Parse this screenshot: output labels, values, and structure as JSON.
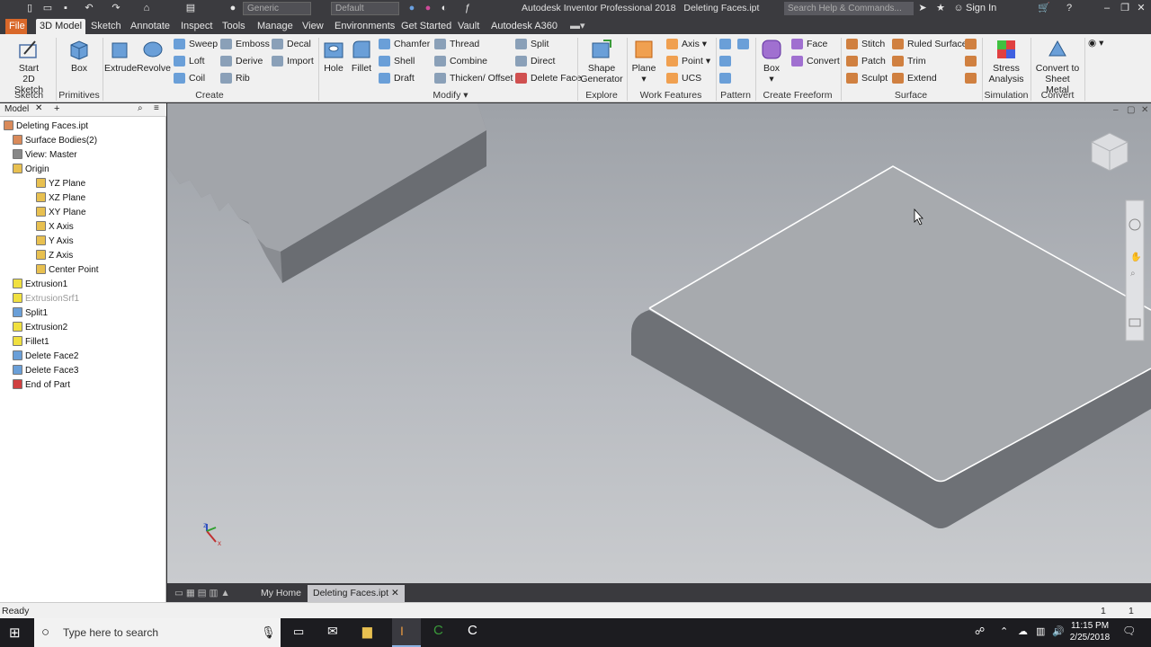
{
  "titlebar": {
    "title": "Autodesk Inventor Professional 2018",
    "document": "Deleting Faces.ipt",
    "material": "Generic",
    "appearance": "Default",
    "search_placeholder": "Search Help & Commands...",
    "sign_in": "Sign In"
  },
  "tabs": [
    "File",
    "3D Model",
    "Sketch",
    "Annotate",
    "Inspect",
    "Tools",
    "Manage",
    "View",
    "Environments",
    "Get Started",
    "Vault",
    "Autodesk A360"
  ],
  "active_tab": "3D Model",
  "ribbon": {
    "sketch": {
      "start": "Start",
      "start2": "2D Sketch",
      "group": "Sketch"
    },
    "primitives": {
      "box": "Box",
      "group": "Primitives"
    },
    "create": {
      "extrude": "Extrude",
      "revolve": "Revolve",
      "sweep": "Sweep",
      "loft": "Loft",
      "coil": "Coil",
      "emboss": "Emboss",
      "derive": "Derive",
      "rib": "Rib",
      "decal": "Decal",
      "import": "Import",
      "group": "Create"
    },
    "modify": {
      "hole": "Hole",
      "fillet": "Fillet",
      "chamfer": "Chamfer",
      "shell": "Shell",
      "draft": "Draft",
      "thread": "Thread",
      "combine": "Combine",
      "thicken": "Thicken/ Offset",
      "split": "Split",
      "direct": "Direct",
      "delete_face": "Delete Face",
      "group": "Modify"
    },
    "explore": {
      "shape": "Shape",
      "generator": "Generator",
      "group": "Explore"
    },
    "work_features": {
      "plane": "Plane",
      "axis": "Axis",
      "point": "Point",
      "ucs": "UCS",
      "group": "Work Features"
    },
    "pattern": {
      "group": "Pattern"
    },
    "freeform": {
      "box": "Box",
      "face": "Face",
      "convert": "Convert",
      "group": "Create Freeform"
    },
    "surface": {
      "stitch": "Stitch",
      "patch": "Patch",
      "sculpt": "Sculpt",
      "ruled": "Ruled Surface",
      "trim": "Trim",
      "extend": "Extend",
      "group": "Surface"
    },
    "simulation": {
      "stress": "Stress",
      "analysis": "Analysis",
      "group": "Simulation"
    },
    "convert": {
      "to": "Convert to",
      "sheet": "Sheet Metal",
      "group": "Convert"
    }
  },
  "browser": {
    "tab_label": "Model",
    "items": [
      {
        "label": "Deleting Faces.ipt",
        "indent": 0,
        "icon": "part-icon"
      },
      {
        "label": "Surface Bodies(2)",
        "indent": 1,
        "icon": "surface-bodies-icon"
      },
      {
        "label": "View: Master",
        "indent": 1,
        "icon": "view-icon"
      },
      {
        "label": "Origin",
        "indent": 1,
        "icon": "folder-icon"
      },
      {
        "label": "YZ Plane",
        "indent": 2,
        "icon": "plane-icon"
      },
      {
        "label": "XZ Plane",
        "indent": 2,
        "icon": "plane-icon"
      },
      {
        "label": "XY Plane",
        "indent": 2,
        "icon": "plane-icon"
      },
      {
        "label": "X Axis",
        "indent": 2,
        "icon": "axis-icon"
      },
      {
        "label": "Y Axis",
        "indent": 2,
        "icon": "axis-icon"
      },
      {
        "label": "Z Axis",
        "indent": 2,
        "icon": "axis-icon"
      },
      {
        "label": "Center Point",
        "indent": 2,
        "icon": "point-icon"
      },
      {
        "label": "Extrusion1",
        "indent": 1,
        "icon": "extrusion-icon"
      },
      {
        "label": "ExtrusionSrf1",
        "indent": 1,
        "icon": "surface-icon",
        "dim": true
      },
      {
        "label": "Split1",
        "indent": 1,
        "icon": "split-icon"
      },
      {
        "label": "Extrusion2",
        "indent": 1,
        "icon": "extrusion-icon"
      },
      {
        "label": "Fillet1",
        "indent": 1,
        "icon": "fillet-icon"
      },
      {
        "label": "Delete Face2",
        "indent": 1,
        "icon": "delete-face-icon"
      },
      {
        "label": "Delete Face3",
        "indent": 1,
        "icon": "delete-face-icon"
      },
      {
        "label": "End of Part",
        "indent": 1,
        "icon": "end-of-part-icon"
      }
    ]
  },
  "doc_tabs": {
    "home": "My Home",
    "active": "Deleting Faces.ipt"
  },
  "status": {
    "text": "Ready",
    "count1": "1",
    "count2": "1"
  },
  "taskbar": {
    "search_placeholder": "Type here to search",
    "time": "11:15 PM",
    "date": "2/25/2018"
  },
  "colors": {
    "file_tab": "#d9682a",
    "accent": "#3b3b3f"
  }
}
